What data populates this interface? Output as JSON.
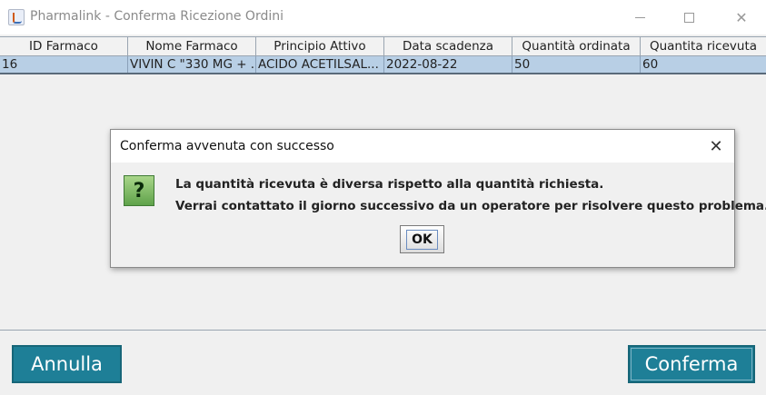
{
  "window": {
    "title": "Pharmalink - Conferma Ricezione Ordini",
    "minimize_icon": "minimize-icon",
    "maximize_icon": "maximize-icon",
    "close_glyph": "✕"
  },
  "table": {
    "columns": [
      "ID Farmaco",
      "Nome Farmaco",
      "Principio Attivo",
      "Data scadenza",
      "Quantità ordinata",
      "Quantita ricevuta"
    ],
    "rows": [
      [
        "16",
        "VIVIN C \"330 MG + ...",
        "ACIDO ACETILSAL...",
        "2022-08-22",
        "50",
        "60"
      ]
    ]
  },
  "buttons": {
    "cancel": "Annulla",
    "confirm": "Conferma"
  },
  "dialog": {
    "title": "Conferma avvenuta con successo",
    "close_glyph": "✕",
    "icon_glyph": "?",
    "line1": "La quantità ricevuta è diversa rispetto alla quantità richiesta.",
    "line2": "Verrai contattato il giorno successivo da un operatore per risolvere questo problema.",
    "ok": "OK"
  },
  "colors": {
    "accent_button": "#1e7f97",
    "selected_row": "#b8cfe5"
  }
}
